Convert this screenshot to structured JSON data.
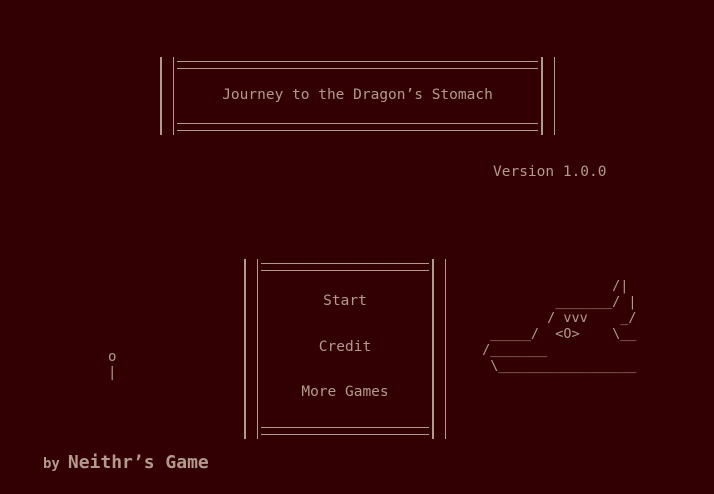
{
  "title": {
    "text": "Journey to the Dragon’s Stomach"
  },
  "version": "Version 1.0.0",
  "menu": {
    "items": [
      {
        "label": "Start"
      },
      {
        "label": "Credit"
      },
      {
        "label": "More Games"
      }
    ]
  },
  "art": {
    "candle": "o\n|",
    "dragon": "                 /|\n          _______/ |\n         / vvv    _/\n  _____/  <O>    \\__\n /_______\n  \\_________________"
  },
  "footer": {
    "by": "by",
    "author": "Neithr’s Game"
  },
  "colors": {
    "background": "#320003",
    "text": "#b49a8c"
  }
}
